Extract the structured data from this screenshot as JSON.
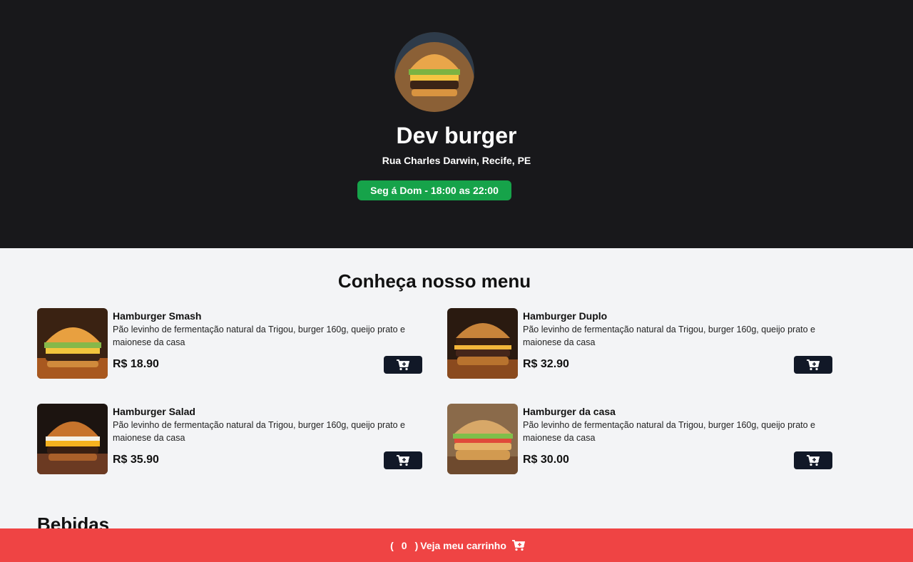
{
  "header": {
    "title": "Dev burger",
    "address": "Rua Charles Darwin, Recife, PE",
    "hours": "Seg á Dom - 18:00 as 22:00",
    "hours_color": "#16a34a"
  },
  "menu": {
    "title": "Conheça nosso menu",
    "add_icon": "cart-plus-icon",
    "items": [
      {
        "name": "Hamburger Smash",
        "description": "Pão levinho de fermentação natural da Trigou, burger 160g, queijo prato e maionese da casa",
        "price": "R$ 18.90"
      },
      {
        "name": "Hamburger Duplo",
        "description": "Pão levinho de fermentação natural da Trigou, burger 160g, queijo prato e maionese da casa",
        "price": "R$ 32.90"
      },
      {
        "name": "Hamburger Salad",
        "description": "Pão levinho de fermentação natural da Trigou, burger 160g, queijo prato e maionese da casa",
        "price": "R$ 35.90"
      },
      {
        "name": "Hamburger da casa",
        "description": "Pão levinho de fermentação natural da Trigou, burger 160g, queijo prato e maionese da casa",
        "price": "R$ 30.00"
      }
    ]
  },
  "drinks": {
    "title": "Bebidas"
  },
  "cart": {
    "open_paren": "(",
    "count": "0",
    "close_paren": ")",
    "label": "Veja meu carrinho",
    "icon": "cart-icon",
    "color": "#ef4444"
  }
}
